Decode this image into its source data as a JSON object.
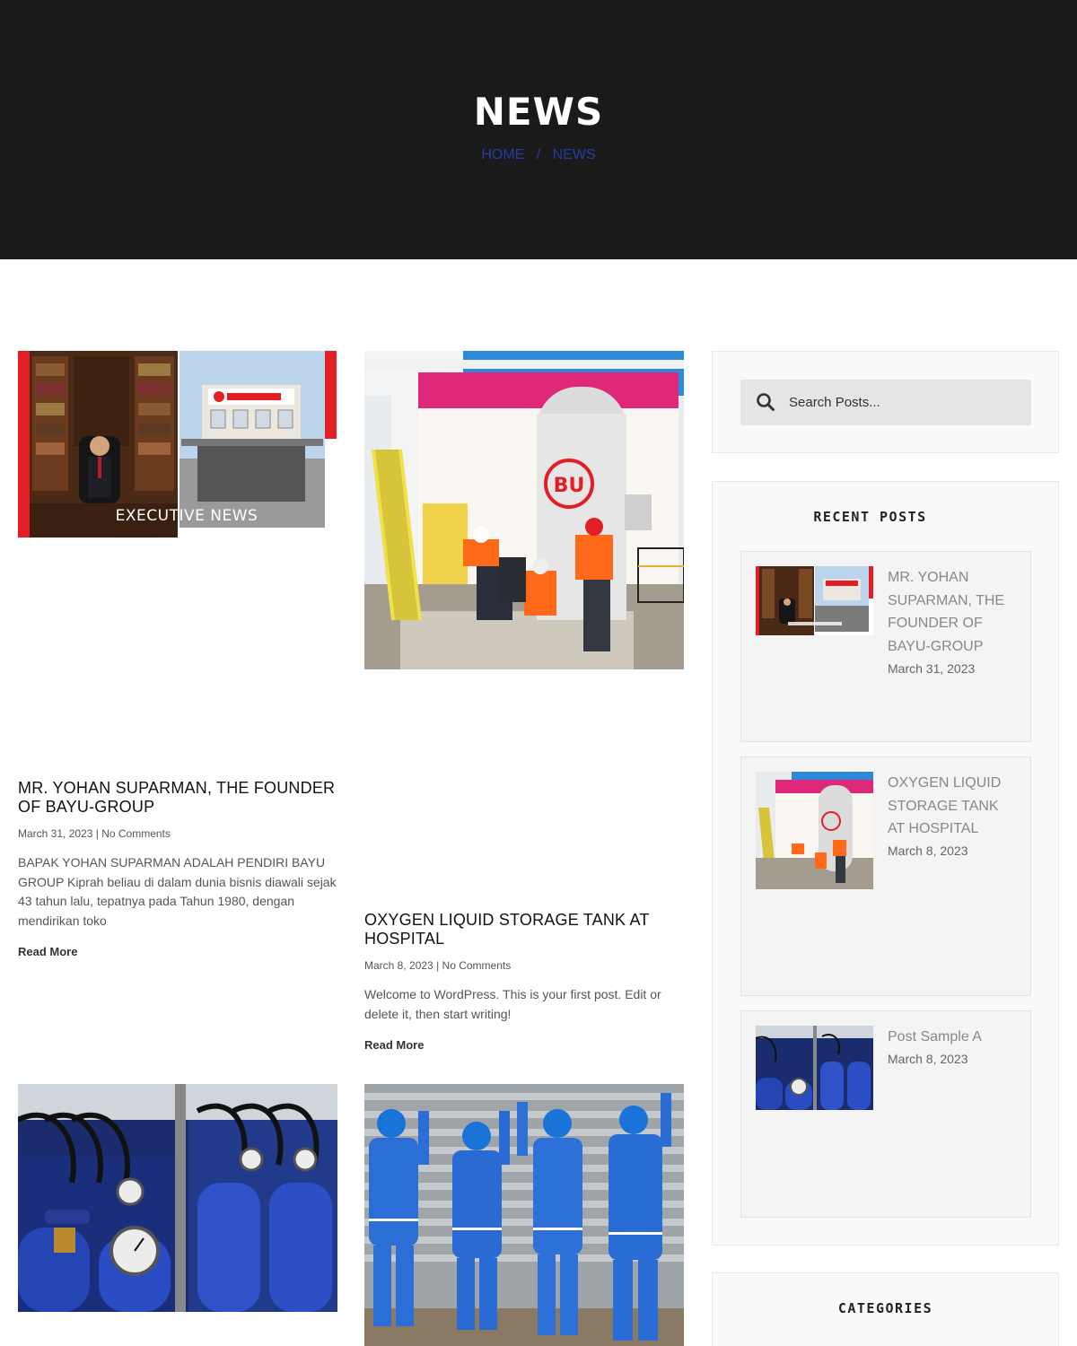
{
  "hero": {
    "title": "NEWS",
    "breadcrumb": {
      "home": "HOME",
      "separator": "/",
      "current": "NEWS"
    }
  },
  "posts": [
    {
      "image_caption": "EXECUTIVE NEWS",
      "title": "MR. YOHAN SUPARMAN, THE FOUNDER OF BAYU-GROUP",
      "date": "March 31, 2023",
      "meta_sep": "|",
      "comments": "No Comments",
      "excerpt": "BAPAK YOHAN SUPARMAN ADALAH PENDIRI BAYU GROUP Kiprah beliau di dalam dunia bisnis diawali sejak 43  tahun lalu, tepatnya pada Tahun 1980, dengan mendirikan toko",
      "read_more": "Read More"
    },
    {
      "title": "OXYGEN LIQUID STORAGE TANK AT HOSPITAL",
      "date": "March 8, 2023",
      "meta_sep": "|",
      "comments": "No Comments",
      "excerpt": "Welcome to WordPress. This is your first post. Edit or delete it, then start writing!",
      "read_more": "Read More"
    }
  ],
  "sidebar": {
    "search": {
      "placeholder": "Search Posts..."
    },
    "recent_posts": {
      "title": "RECENT POSTS",
      "items": [
        {
          "title": "MR. YOHAN SUPARMAN, THE FOUNDER OF BAYU-GROUP",
          "date": "March 31, 2023"
        },
        {
          "title": "OXYGEN LIQUID STORAGE TANK AT HOSPITAL",
          "date": "March 8, 2023"
        },
        {
          "title": "Post Sample A",
          "date": "March 8, 2023"
        }
      ]
    },
    "categories": {
      "title": "CATEGORIES"
    }
  },
  "colors": {
    "hero_bg": "#1a1a1a",
    "breadcrumb_link": "#2a3aa5",
    "brand_red": "#e31e24",
    "industrial_blue": "#1f3fa8"
  }
}
